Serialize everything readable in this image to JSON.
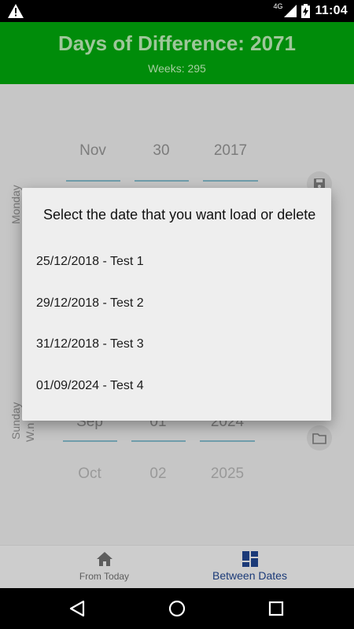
{
  "status_bar": {
    "network_label": "4G",
    "time": "11:04"
  },
  "header": {
    "title": "Days of Difference: 2071",
    "subtitle": "Weeks: 295"
  },
  "picker_top": {
    "month": "Nov",
    "day": "30",
    "year": "2017",
    "weekday": "Monday"
  },
  "picker_bottom": {
    "month": "Sep",
    "day": "01",
    "year": "2024",
    "next_month": "Oct",
    "next_day": "02",
    "next_year": "2025",
    "weekday": "Sunday",
    "weekday2": "W.n"
  },
  "dialog": {
    "title": "Select the date that you want load or delete",
    "items": [
      "25/12/2018 - Test 1",
      "29/12/2018 - Test 2",
      "31/12/2018 - Test 3",
      "01/09/2024 - Test 4"
    ]
  },
  "bottom_nav": {
    "items": [
      {
        "label": "From Today",
        "icon": "home-icon"
      },
      {
        "label": "Between Dates",
        "icon": "dashboard-icon"
      }
    ],
    "active_index": 1
  },
  "colors": {
    "header_bg": "#008c0a",
    "active_nav": "#1b3a78",
    "dialog_bg": "#eeeeee"
  }
}
